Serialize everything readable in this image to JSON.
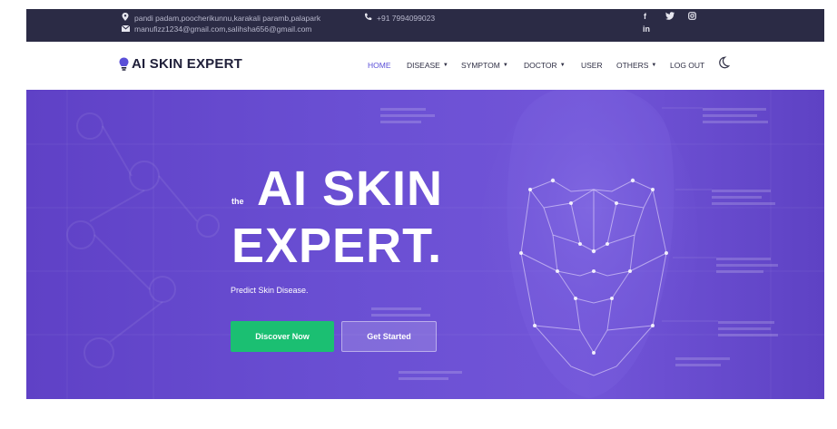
{
  "topbar": {
    "address": "pandi padam,poocherikunnu,karakali paramb,palapark",
    "emails": "manufizz1234@gmail.com,salihsha656@gmail.com",
    "phone": "+91 7994099023",
    "social_icons": [
      "facebook-icon",
      "twitter-icon",
      "instagram-icon",
      "linkedin-icon"
    ]
  },
  "nav": {
    "brand": "AI SKIN EXPERT",
    "items": [
      {
        "label": "HOME",
        "active": true,
        "dropdown": false
      },
      {
        "label": "DISEASE",
        "active": false,
        "dropdown": true
      },
      {
        "label": "SYMPTOM",
        "active": false,
        "dropdown": true
      },
      {
        "label": "DOCTOR",
        "active": false,
        "dropdown": true
      },
      {
        "label": "USER",
        "active": false,
        "dropdown": false
      },
      {
        "label": "OTHERS",
        "active": false,
        "dropdown": true
      },
      {
        "label": "LOG OUT",
        "active": false,
        "dropdown": false
      }
    ]
  },
  "hero": {
    "prefix": "the",
    "title_line1": "AI SKIN",
    "title_line2": "EXPERT.",
    "subtitle": "Predict Skin Disease.",
    "primary_button": "Discover Now",
    "secondary_button": "Get Started"
  },
  "colors": {
    "topbar_bg": "#2b2b45",
    "accent": "#5a4fd8",
    "hero_bg": "#6a4fd3",
    "primary_button": "#1bbf72"
  }
}
